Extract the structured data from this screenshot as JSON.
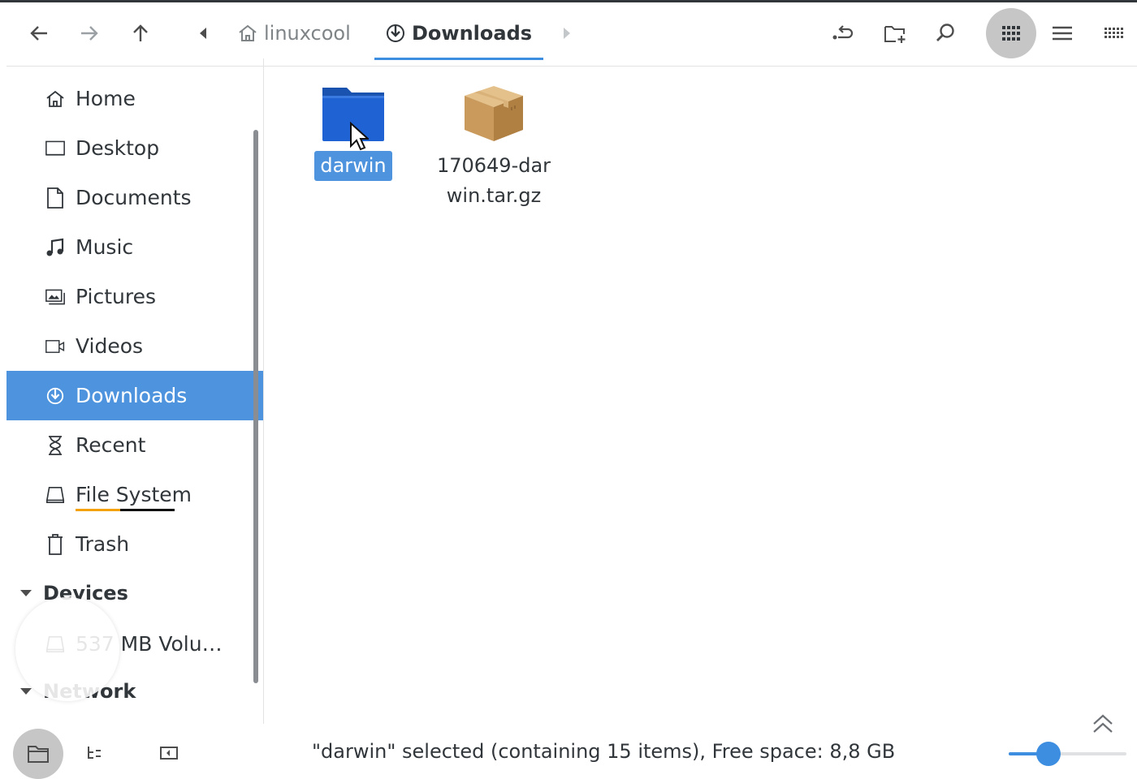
{
  "toolbar": {
    "breadcrumbs": [
      {
        "label": "linuxcool",
        "icon": "home-icon"
      },
      {
        "label": "Downloads",
        "icon": "download-icon"
      }
    ],
    "view_mode": "icons"
  },
  "sidebar": {
    "places": [
      {
        "label": "Home",
        "icon": "home-icon"
      },
      {
        "label": "Desktop",
        "icon": "desktop-icon"
      },
      {
        "label": "Documents",
        "icon": "document-icon"
      },
      {
        "label": "Music",
        "icon": "music-icon"
      },
      {
        "label": "Pictures",
        "icon": "pictures-icon"
      },
      {
        "label": "Videos",
        "icon": "video-icon"
      },
      {
        "label": "Downloads",
        "icon": "download-icon",
        "active": true
      },
      {
        "label": "Recent",
        "icon": "hourglass-icon"
      },
      {
        "label": "File System",
        "icon": "drive-icon"
      },
      {
        "label": "Trash",
        "icon": "trash-icon"
      }
    ],
    "devices_header": "Devices",
    "devices": [
      {
        "label": "537 MB Volu…",
        "icon": "drive-icon"
      }
    ],
    "network_header": "Network"
  },
  "files": [
    {
      "name": "darwin",
      "type": "folder",
      "selected": true,
      "icon": "folder-icon"
    },
    {
      "name": "170649-darwin.tar.gz",
      "type": "archive",
      "selected": false,
      "icon": "package-icon"
    }
  ],
  "statusbar": {
    "text": "\"darwin\" selected (containing 15 items), Free space: 8,8 GB",
    "zoom_fraction": 0.34
  },
  "colors": {
    "accent": "#3d8ee0",
    "selection": "#4d93dd",
    "folder": "#1f62d3"
  }
}
